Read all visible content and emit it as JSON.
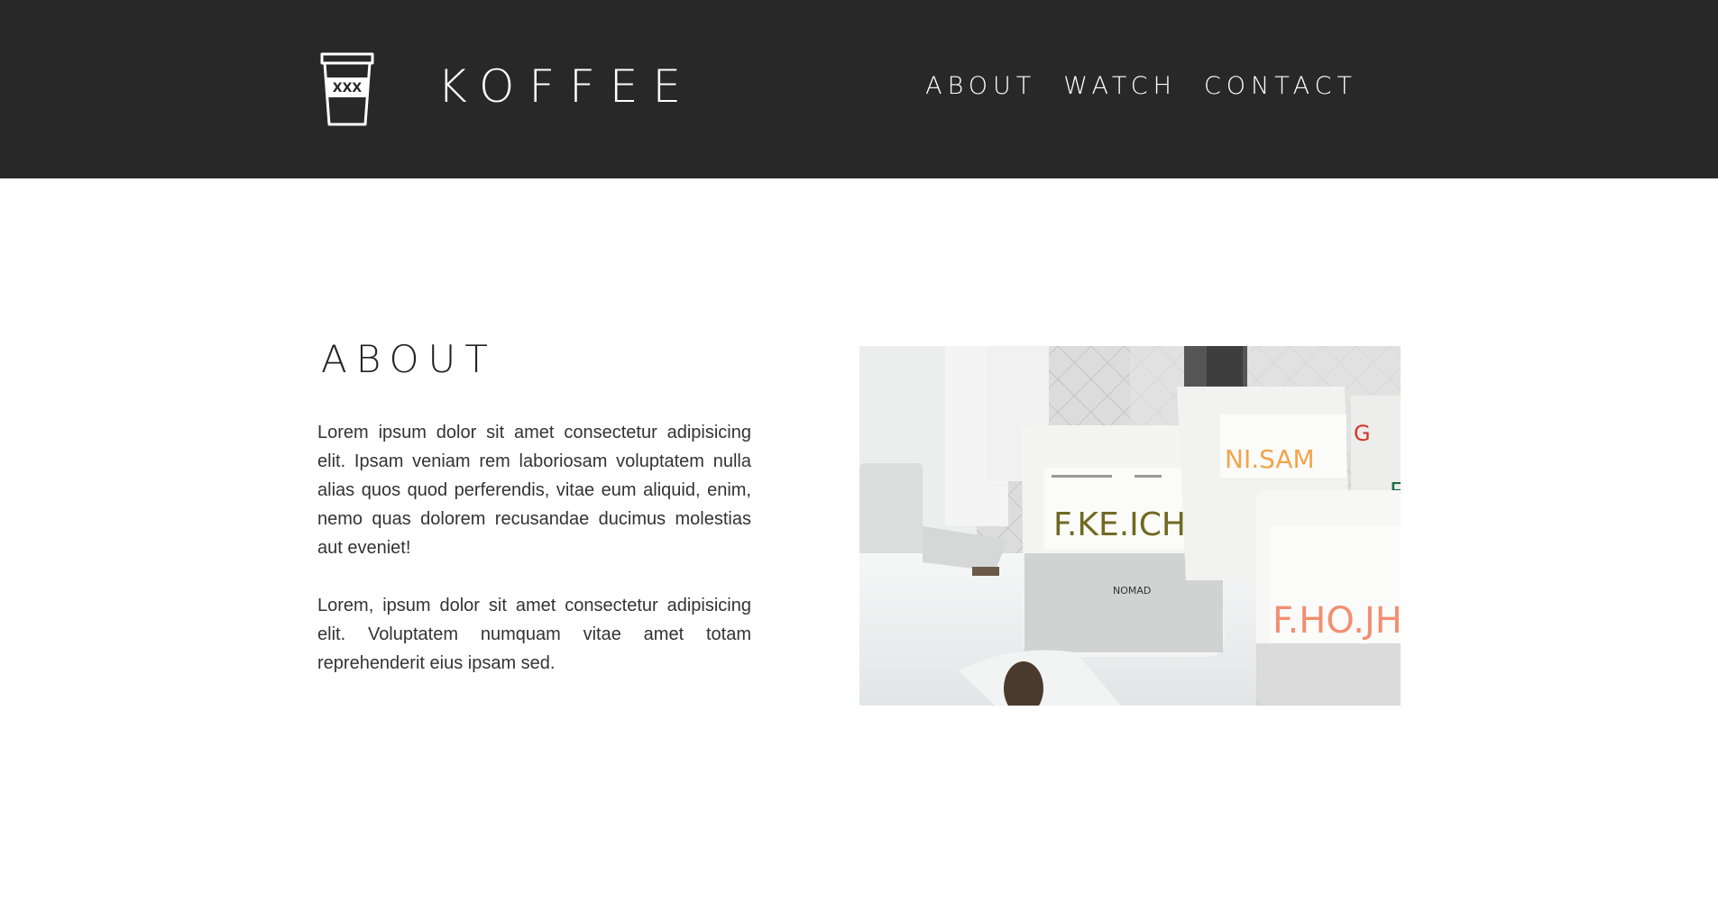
{
  "header": {
    "brand": "KOFFEE",
    "logo_icon": "coffee-cup-icon",
    "logo_mark": "XXX",
    "nav": [
      {
        "label": "ABOUT"
      },
      {
        "label": "WATCH"
      },
      {
        "label": "CONTACT"
      }
    ],
    "background": "#282828"
  },
  "about": {
    "title": "ABOUT",
    "paragraphs": [
      "Lorem ipsum dolor sit amet consectetur adipisicing elit. Ipsam veniam rem laboriosam voluptatem nulla alias quos quod perferendis, vitae eum aliquid, enim, nemo quas dolorem recusandae ducimus molestias aut eveniet!",
      "Lorem, ipsum dolor sit amet consectetur adipisicing elit. Voluptatem numquam vitae amet totam reprehenderit eius ipsam sed."
    ]
  },
  "photo": {
    "bag_labels": [
      "F.KE.ICH",
      "NI.SAM",
      "F.HO.JH",
      "NOMAD"
    ],
    "label_colors": {
      "f_ke_ich": "#6f6a22",
      "ni_sam": "#f2a54a",
      "f_ho_jh": "#f18f70"
    }
  }
}
